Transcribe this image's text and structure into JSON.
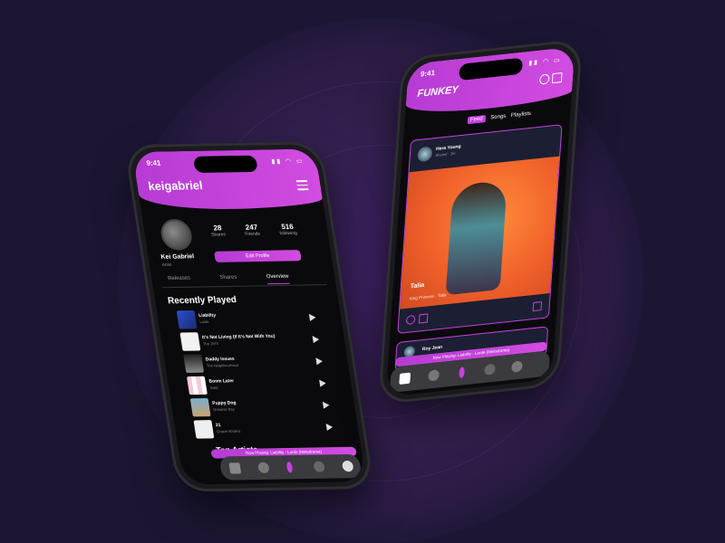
{
  "colors": {
    "background": "#1c1633",
    "accent": "#c541e0",
    "gradient_end": "#d24ce0"
  },
  "profile_phone": {
    "time": "9:41",
    "username": "keigabriel",
    "name": "Kei Gabriel",
    "role": "Artist",
    "stats": [
      {
        "value": "28",
        "label": "Shares"
      },
      {
        "value": "247",
        "label": "Friends"
      },
      {
        "value": "516",
        "label": "following"
      }
    ],
    "edit_button": "Edit Profile",
    "tabs": [
      "Releases",
      "Shares",
      "Overview"
    ],
    "active_tab": "Overview",
    "section_title": "Recently Played",
    "songs": [
      {
        "title": "Liability",
        "artist": "Lorde"
      },
      {
        "title": "It's Not Living (If It's Not With You)",
        "artist": "The 1975"
      },
      {
        "title": "Daddy Issues",
        "artist": "The Neighbourhood"
      },
      {
        "title": "Boom Later",
        "artist": "Isaac"
      },
      {
        "title": "Puppy Dog",
        "artist": "Dreamer Boy"
      },
      {
        "title": "21",
        "artist": "Gracie Abrams"
      }
    ],
    "next_section": "Top Artists",
    "now_playing": "Now Playing: Liability - Lorde (Melodrama)",
    "nav_icons": [
      "home-icon",
      "add-icon",
      "music-icon",
      "bell-icon",
      "profile-icon"
    ]
  },
  "feed_phone": {
    "time": "9:41",
    "logo": "FUNKEY",
    "tabs": [
      "Feed",
      "Songs",
      "Playlists"
    ],
    "active_tab": "Feed",
    "post": {
      "user": "Hera Young",
      "meta": "Shared · 2hr",
      "song": "Talia",
      "artist": "King Princess · Talia"
    },
    "post2_user": "Roy Jean",
    "now_playing": "Now Playing: Liability - Lorde (Melodrama)",
    "nav_icons": [
      "home-icon",
      "add-icon",
      "music-icon",
      "bell-icon",
      "profile-icon"
    ]
  }
}
